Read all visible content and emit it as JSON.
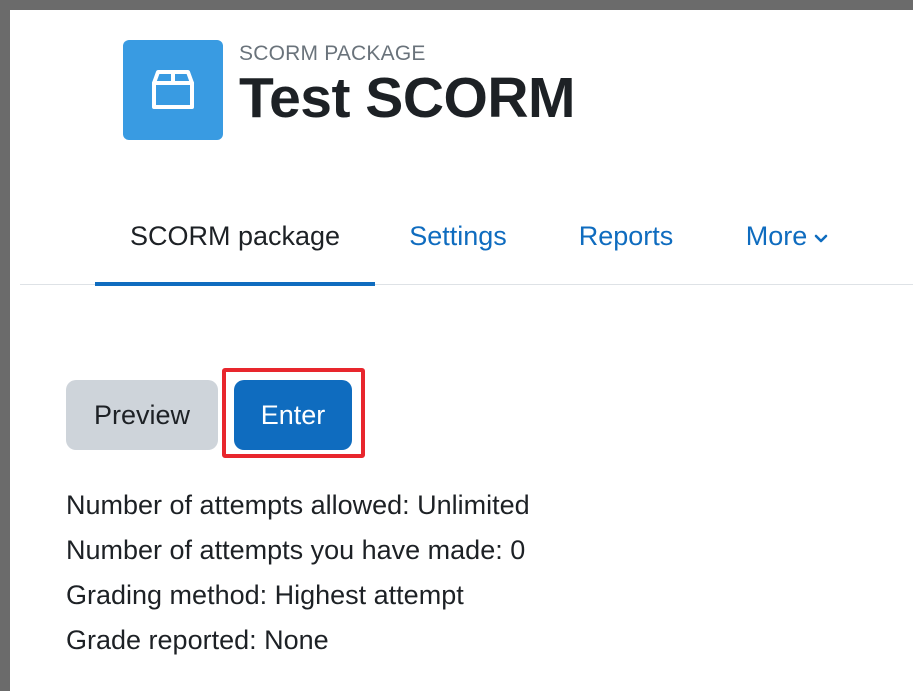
{
  "header": {
    "icon": "package-box-icon",
    "pre_title": "SCORM PACKAGE",
    "title": "Test SCORM",
    "icon_color": "#399be2"
  },
  "nav": {
    "tabs": [
      {
        "label": "SCORM package",
        "active": true
      },
      {
        "label": "Settings",
        "active": false
      },
      {
        "label": "Reports",
        "active": false
      },
      {
        "label": "More",
        "active": false,
        "icon": "chevron-down-icon"
      }
    ]
  },
  "actions": {
    "preview_label": "Preview",
    "enter_label": "Enter",
    "highlighted": "Enter",
    "highlight_color": "#e8262d"
  },
  "info": [
    "Number of attempts allowed: Unlimited",
    "Number of attempts you have made: 0",
    "Grading method: Highest attempt",
    "Grade reported: None"
  ],
  "colors": {
    "primary": "#0f6cbf",
    "secondary_button": "#ced4da",
    "text": "#1d2125"
  }
}
